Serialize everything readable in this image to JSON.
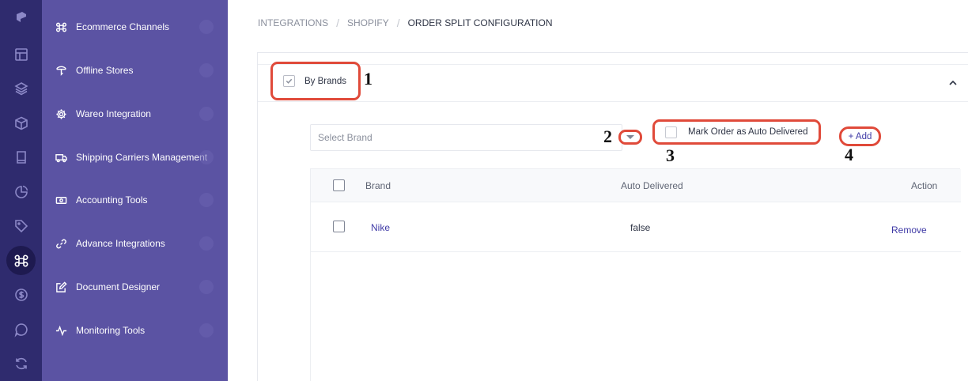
{
  "rail": {
    "icons": [
      "logo-icon",
      "layout-icon",
      "layers-icon",
      "box-icon",
      "book-icon",
      "chart-pie-icon",
      "tag-icon",
      "command-icon",
      "dollar-icon",
      "chat-icon",
      "sync-icon"
    ],
    "active": "command-icon"
  },
  "menu": {
    "items": [
      {
        "label": "Ecommerce Channels",
        "icon": "command-icon"
      },
      {
        "label": "Offline Stores",
        "icon": "store-icon"
      },
      {
        "label": "Wareo Integration",
        "icon": "gear-icon"
      },
      {
        "label": "Shipping Carriers Management",
        "icon": "truck-icon"
      },
      {
        "label": "Accounting Tools",
        "icon": "money-icon"
      },
      {
        "label": "Advance Integrations",
        "icon": "link-icon"
      },
      {
        "label": "Document Designer",
        "icon": "edit-icon"
      },
      {
        "label": "Monitoring Tools",
        "icon": "activity-icon"
      }
    ]
  },
  "breadcrumb": {
    "items": [
      "INTEGRATIONS",
      "SHOPIFY",
      "ORDER SPLIT CONFIGURATION"
    ]
  },
  "panel": {
    "section_label": "By Brands",
    "select_placeholder": "Select Brand",
    "auto_delivered_label": "Mark Order as Auto Delivered",
    "add_label": "+ Add"
  },
  "annotations": [
    "1",
    "2",
    "3",
    "4"
  ],
  "table": {
    "headers": {
      "brand": "Brand",
      "auto_delivered": "Auto Delivered",
      "action": "Action"
    },
    "rows": [
      {
        "brand": "Nike",
        "auto_delivered": "false",
        "action": "Remove"
      }
    ]
  },
  "colors": {
    "rail": "#2f2b6e",
    "menu": "#5b53a3",
    "accent": "#3f3aa6",
    "highlight": "#e04a3a"
  }
}
